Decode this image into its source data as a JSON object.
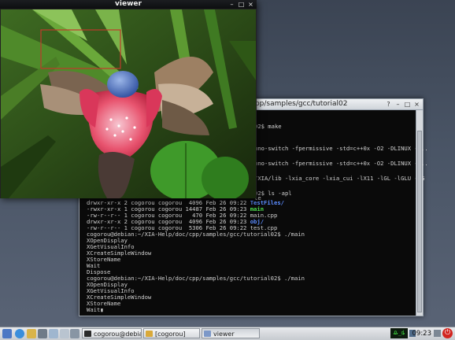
{
  "terminal": {
    "title": "cpp/samples/gcc/tutorial02",
    "buttons": {
      "help": "?",
      "minimize": "–",
      "maximize": "□",
      "close": "×"
    },
    "right_lines": [
      "02$ make",
      "uno-switch -fpermissive -std=c++0x -O2 -DLINUX -I..",
      "uno-switch -fpermissive -std=c++0x -O2 -DLINUX -I..",
      "/XIA/lib -lxia_core -lxia_cui -lX11 -lGL -lGLU -lG",
      "02$ ls -apl",
      "le"
    ],
    "listing": [
      {
        "perm": "drwxr-xr-x 2 cogorou cogorou  4096 Feb 26 09:22 ",
        "name": "TestFiles/",
        "kind": "dir"
      },
      {
        "perm": "-rwxr-xr-x 1 cogorou cogorou 14487 Feb 26 09:23 ",
        "name": "main",
        "kind": "exec"
      },
      {
        "perm": "-rw-r--r-- 1 cogorou cogorou   470 Feb 26 09:22 ",
        "name": "main.cpp",
        "kind": "file"
      },
      {
        "perm": "drwxr-xr-x 2 cogorou cogorou  4096 Feb 26 09:23 ",
        "name": "obj/",
        "kind": "dir"
      },
      {
        "perm": "-rw-r--r-- 1 cogorou cogorou  5306 Feb 26 09:22 ",
        "name": "test.cpp",
        "kind": "file"
      }
    ],
    "lines": [
      "cogorou@debian:~/XIA-Help/doc/cpp/samples/gcc/tutorial02$ ./main",
      "XOpenDisplay",
      "XGetVisualInfo",
      "XCreateSimpleWindow",
      "XStoreName",
      "Wait",
      "Dispose",
      "cogorou@debian:~/XIA-Help/doc/cpp/samples/gcc/tutorial02$ ./main",
      "XOpenDisplay",
      "XGetVisualInfo",
      "XCreateSimpleWindow",
      "XStoreName",
      "Wait"
    ],
    "cursor": "▮"
  },
  "viewer": {
    "title": "viewer",
    "buttons": {
      "minimize": "–",
      "maximize": "□",
      "close": "×"
    }
  },
  "taskbar": {
    "tasks": [
      {
        "label": "cogorou@debian..."
      },
      {
        "label": "[cogorou]"
      },
      {
        "label": "viewer"
      }
    ],
    "clock": "09:23",
    "tray_text": "Ꮂ_ȡ"
  },
  "colors": {
    "desktop": "#4a5566",
    "terminal_bg": "#0a0a0a",
    "dir_blue": "#5b8cff",
    "exec_green": "#4fdf4f",
    "selection_box": "#c0392b"
  }
}
